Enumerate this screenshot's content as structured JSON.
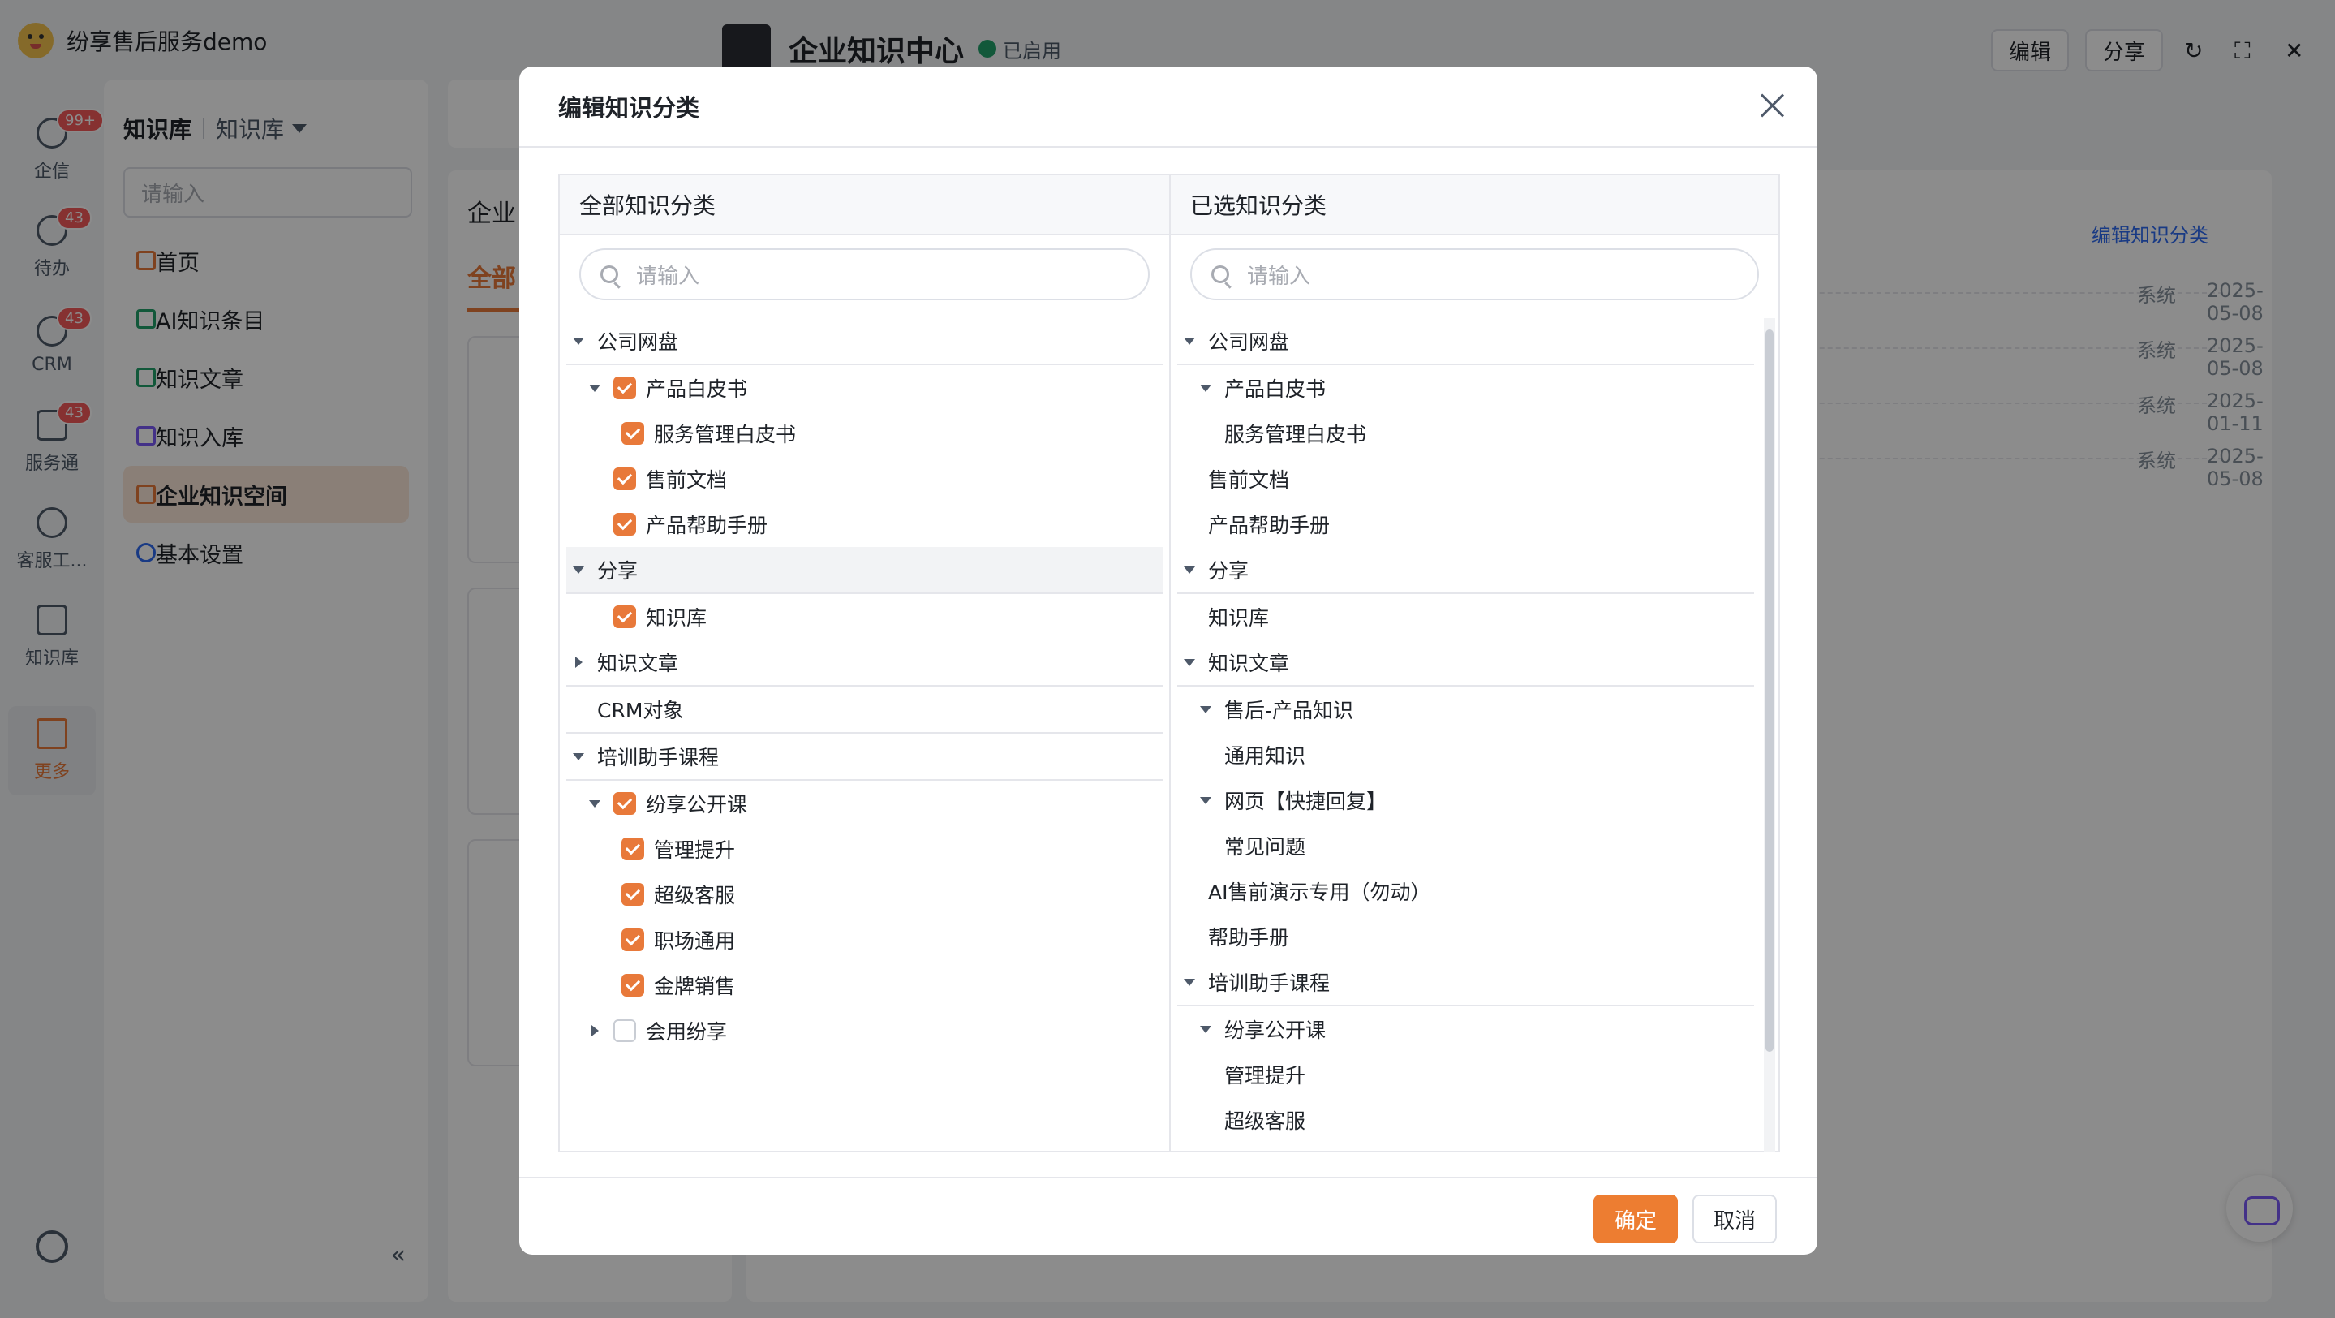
{
  "app": {
    "title": "纷享售后服务demo"
  },
  "rail": {
    "items": [
      {
        "label": "企信",
        "badge": "99+"
      },
      {
        "label": "待办",
        "badge": "43"
      },
      {
        "label": "CRM",
        "badge": "43"
      },
      {
        "label": "服务通",
        "badge": "43"
      },
      {
        "label": "客服工...",
        "badge": ""
      },
      {
        "label": "知识库",
        "badge": ""
      },
      {
        "label": "更多",
        "badge": ""
      }
    ]
  },
  "sidebar": {
    "title": "知识库",
    "subtitle": "知识库",
    "search_placeholder": "请输入",
    "items": [
      {
        "label": "首页"
      },
      {
        "label": "AI知识条目"
      },
      {
        "label": "知识文章"
      },
      {
        "label": "知识入库"
      },
      {
        "label": "企业知识空间"
      },
      {
        "label": "基本设置"
      }
    ]
  },
  "main": {
    "title": "企业知识中心",
    "status": "已启用",
    "edit_btn": "编辑",
    "share_btn": "分享",
    "card_title": "企业",
    "tab_all": "全部",
    "edit_category_link": "编辑知识分类",
    "rows": [
      {
        "by": "系统",
        "date": "2025-05-08"
      },
      {
        "by": "系统",
        "date": "2025-05-08"
      },
      {
        "by": "系统",
        "date": "2025-01-11"
      },
      {
        "by": "系统",
        "date": "2025-05-08"
      }
    ]
  },
  "modal": {
    "title": "编辑知识分类",
    "left_title": "全部知识分类",
    "right_title": "已选知识分类",
    "search_placeholder": "请输入",
    "ok": "确定",
    "cancel": "取消",
    "left_tree": [
      {
        "label": "公司网盘",
        "level": 0,
        "arrow": "down",
        "check": "none"
      },
      {
        "label": "产品白皮书",
        "level": 1,
        "arrow": "down",
        "check": "on"
      },
      {
        "label": "服务管理白皮书",
        "level": 2,
        "arrow": "none",
        "check": "on"
      },
      {
        "label": "售前文档",
        "level": 1,
        "arrow": "none",
        "check": "on"
      },
      {
        "label": "产品帮助手册",
        "level": 1,
        "arrow": "none",
        "check": "on"
      },
      {
        "label": "分享",
        "level": 0,
        "arrow": "down",
        "check": "none"
      },
      {
        "label": "知识库",
        "level": 1,
        "arrow": "none",
        "check": "on"
      },
      {
        "label": "知识文章",
        "level": 0,
        "arrow": "right",
        "check": "none"
      },
      {
        "label": "CRM对象",
        "level": 0,
        "arrow": "none",
        "check": "none"
      },
      {
        "label": "培训助手课程",
        "level": 0,
        "arrow": "down",
        "check": "none"
      },
      {
        "label": "纷享公开课",
        "level": 1,
        "arrow": "down",
        "check": "on"
      },
      {
        "label": "管理提升",
        "level": 2,
        "arrow": "none",
        "check": "on"
      },
      {
        "label": "超级客服",
        "level": 2,
        "arrow": "none",
        "check": "on"
      },
      {
        "label": "职场通用",
        "level": 2,
        "arrow": "none",
        "check": "on"
      },
      {
        "label": "金牌销售",
        "level": 2,
        "arrow": "none",
        "check": "on"
      },
      {
        "label": "会用纷享",
        "level": 1,
        "arrow": "right",
        "check": "off"
      }
    ],
    "right_tree": [
      {
        "label": "公司网盘",
        "level": 0,
        "arrow": "down"
      },
      {
        "label": "产品白皮书",
        "level": 1,
        "arrow": "down"
      },
      {
        "label": "服务管理白皮书",
        "level": 2,
        "arrow": "none"
      },
      {
        "label": "售前文档",
        "level": 1,
        "arrow": "none"
      },
      {
        "label": "产品帮助手册",
        "level": 1,
        "arrow": "none"
      },
      {
        "label": "分享",
        "level": 0,
        "arrow": "down"
      },
      {
        "label": "知识库",
        "level": 1,
        "arrow": "none"
      },
      {
        "label": "知识文章",
        "level": 0,
        "arrow": "down"
      },
      {
        "label": "售后-产品知识",
        "level": 1,
        "arrow": "down"
      },
      {
        "label": "通用知识",
        "level": 2,
        "arrow": "none"
      },
      {
        "label": "网页【快捷回复】",
        "level": 1,
        "arrow": "down"
      },
      {
        "label": "常见问题",
        "level": 2,
        "arrow": "none"
      },
      {
        "label": "AI售前演示专用（勿动）",
        "level": 1,
        "arrow": "none"
      },
      {
        "label": "帮助手册",
        "level": 1,
        "arrow": "none"
      },
      {
        "label": "培训助手课程",
        "level": 0,
        "arrow": "down"
      },
      {
        "label": "纷享公开课",
        "level": 1,
        "arrow": "down"
      },
      {
        "label": "管理提升",
        "level": 2,
        "arrow": "none"
      },
      {
        "label": "超级客服",
        "level": 2,
        "arrow": "none"
      }
    ]
  },
  "colors": {
    "accent": "#ed7d31",
    "link": "#2f6bf0",
    "status_green": "#22a06b"
  }
}
